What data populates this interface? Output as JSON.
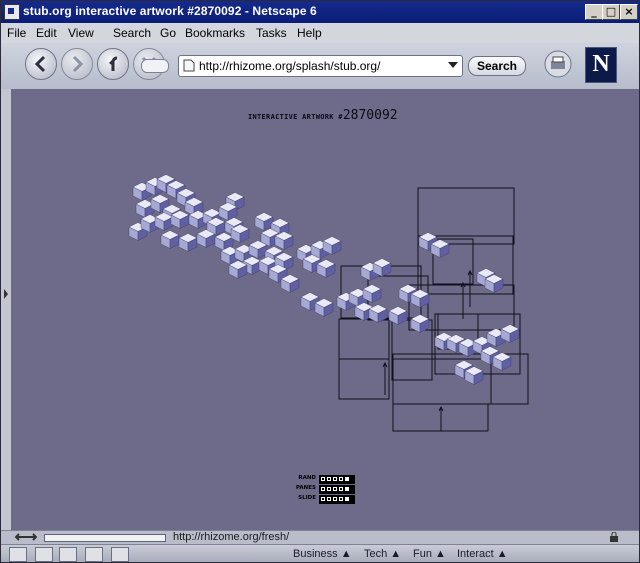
{
  "window": {
    "title": "stub.org interactive artwork #2870092 - Netscape 6"
  },
  "menu": [
    "File",
    "Edit",
    "View",
    "Search",
    "Go",
    "Bookmarks",
    "Tasks",
    "Help"
  ],
  "toolbar": {
    "url": "http://rhizome.org/splash/stub.org/",
    "search_label": "Search",
    "logo_letter": "N"
  },
  "artwork": {
    "title": "INTERACTIVE ARTWORK #",
    "number": "2870092",
    "controls": [
      {
        "label": "RAND"
      },
      {
        "label": "PANES"
      },
      {
        "label": "SLIDE"
      }
    ]
  },
  "status": {
    "text": "http://rhizome.org/fresh/"
  },
  "taskbar": {
    "tabs": [
      "Business",
      "Tech",
      "Fun",
      "Interact"
    ]
  },
  "colors": {
    "canvas": "#6e6a8a",
    "cube_top": "#e9eaf6",
    "cube_left": "#a7a9d5",
    "cube_right": "#5f5fa2"
  }
}
